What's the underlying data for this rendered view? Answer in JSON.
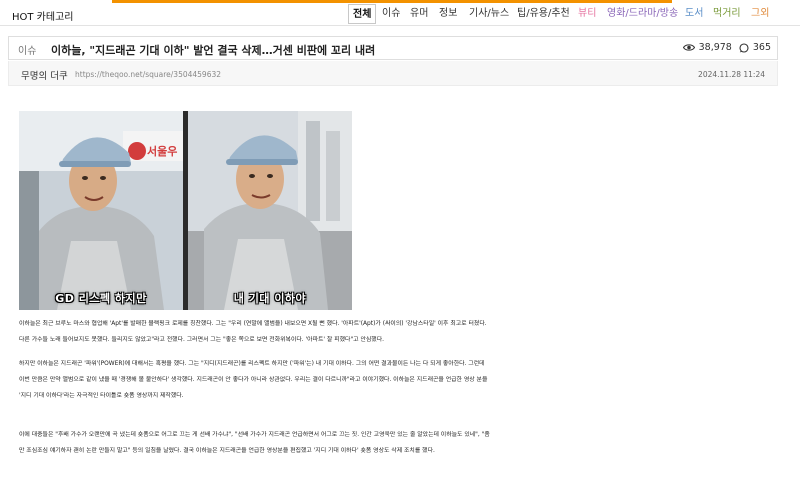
{
  "nav": {
    "hot_label": "HOT 카테고리",
    "items": [
      {
        "label": "전체",
        "color": "#111111"
      },
      {
        "label": "이슈",
        "color": "#333333"
      },
      {
        "label": "유머",
        "color": "#333333"
      },
      {
        "label": "정보",
        "color": "#333333"
      },
      {
        "label": "기사/뉴스",
        "color": "#333333"
      },
      {
        "label": "팁/유용/추천",
        "color": "#333333"
      },
      {
        "label": "뷰티",
        "color": "#e573a0"
      },
      {
        "label": "영화/드라마/방송",
        "color": "#8a66b8"
      },
      {
        "label": "도서",
        "color": "#5b8fc8"
      },
      {
        "label": "먹거리",
        "color": "#7a9a3a"
      },
      {
        "label": "그외",
        "color": "#e08a3a"
      }
    ]
  },
  "article": {
    "category": "이슈",
    "title": "이하늘, \"지드래곤 기대 이하\" 발언 결국 삭제…거센 비판에 꼬리 내려",
    "views": "38,978",
    "comments": "365",
    "author": "무명의 더쿠",
    "url": "https://theqoo.net/square/3504459632",
    "date": "2024.11.28 11:24"
  },
  "image": {
    "caption_left": "GD 리스펙 하지만",
    "caption_right": "내 기대 이하야"
  },
  "paragraphs": {
    "p1_l1": "이하늘은 최근 브루노 마스와 협업해 'Apt'를 발매한 블랙핑크 로제를 칭찬했다. 그는 \"우리 (연말에 앨범을) 내보으면 X될 뻔 했다. '아파트'(Apt)가 (싸이의) '강남스타일' 이후 최고로 터졌다.",
    "p1_l2": "다른 가수들 노래 들어보지도 못했다. 들리지도 않았고\"라고 전했다. 그러면서 그는 \"좋은 쪽으로 보면 전화위복이다. '아파트' 잘 피했다\"고 안심했다.",
    "p2_l1": "하지만 이하늘은 지드래곤 '파워'(POWER)에 대해서는 혹평을 했다. 그는 \"지디(지드래곤)를 리스펙트 하지만 ('파워'는) 내 기대 이하다. 그의 어떤 결과물이든 나는 다 되게 좋아한다. 그런데",
    "p2_l2": "이번 만큼은 만약 앨범으로 같이 냈을 때 '경쟁해 볼 불안하다' 생각했다. 지드래곤이 안 좋다가 아니라 상관없다. 우리는 결이 다르니까\"라고 이야기했다. 이하늘은 지드래곤을 언급한 영상 분을",
    "p2_l3": "'지디 기대 이하다'라는 자극적인 타이틀로 숏폼 영상까지 제작했다.",
    "p3_l1": "이에 대중들은 \"후배 가수가 오랜만에 곡 냈는데 숏폼으로 어그로 끄는 게 선배 가수냐\", \"선배 가수가 지드래곤 언급하면서 어그로 끄는 짓. 인간 고영욱만 있는 줄 알았는데 이하늘도 있네\", \"좀",
    "p3_l2": "만 조심조심 얘기하자 괜히 논란 만들지 말고\" 등의 일침을 날렸다. 결국 이하늘은 지드래곤을 언급한 영상분을 편집했고 '지디 기대 이하다' 숏폼 영상도 삭제 조치를 했다."
  },
  "icons": {
    "views": "eye-icon",
    "comments": "comment-icon"
  },
  "colors": {
    "accent": "#f39200"
  }
}
